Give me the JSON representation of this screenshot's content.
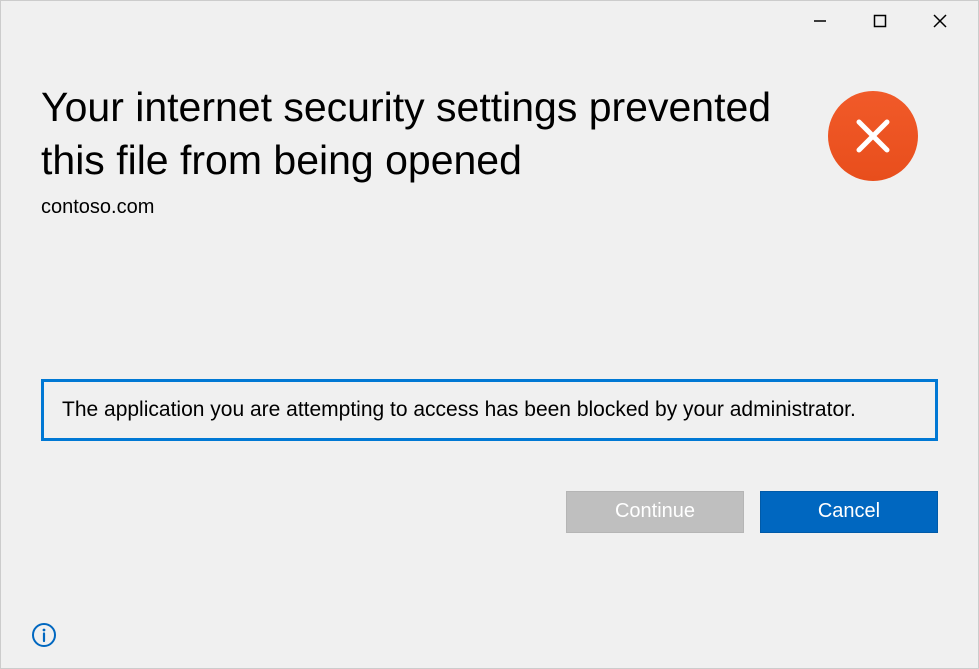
{
  "heading": "Your internet security settings prevented this file from being opened",
  "domain": "contoso.com",
  "message": "The application you are attempting to access has been blocked by your administrator.",
  "buttons": {
    "continue": "Continue",
    "cancel": "Cancel"
  },
  "colors": {
    "accent": "#0078d4",
    "primary_button": "#0067c0",
    "error_icon": "#e84e1c"
  }
}
